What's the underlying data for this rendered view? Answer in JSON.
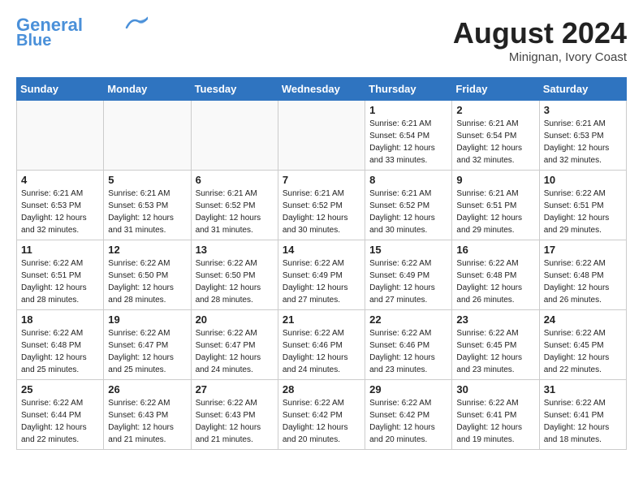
{
  "header": {
    "logo_line1": "General",
    "logo_line2": "Blue",
    "month_year": "August 2024",
    "location": "Minignan, Ivory Coast"
  },
  "weekdays": [
    "Sunday",
    "Monday",
    "Tuesday",
    "Wednesday",
    "Thursday",
    "Friday",
    "Saturday"
  ],
  "weeks": [
    [
      {
        "day": "",
        "info": ""
      },
      {
        "day": "",
        "info": ""
      },
      {
        "day": "",
        "info": ""
      },
      {
        "day": "",
        "info": ""
      },
      {
        "day": "1",
        "info": "Sunrise: 6:21 AM\nSunset: 6:54 PM\nDaylight: 12 hours\nand 33 minutes."
      },
      {
        "day": "2",
        "info": "Sunrise: 6:21 AM\nSunset: 6:54 PM\nDaylight: 12 hours\nand 32 minutes."
      },
      {
        "day": "3",
        "info": "Sunrise: 6:21 AM\nSunset: 6:53 PM\nDaylight: 12 hours\nand 32 minutes."
      }
    ],
    [
      {
        "day": "4",
        "info": "Sunrise: 6:21 AM\nSunset: 6:53 PM\nDaylight: 12 hours\nand 32 minutes."
      },
      {
        "day": "5",
        "info": "Sunrise: 6:21 AM\nSunset: 6:53 PM\nDaylight: 12 hours\nand 31 minutes."
      },
      {
        "day": "6",
        "info": "Sunrise: 6:21 AM\nSunset: 6:52 PM\nDaylight: 12 hours\nand 31 minutes."
      },
      {
        "day": "7",
        "info": "Sunrise: 6:21 AM\nSunset: 6:52 PM\nDaylight: 12 hours\nand 30 minutes."
      },
      {
        "day": "8",
        "info": "Sunrise: 6:21 AM\nSunset: 6:52 PM\nDaylight: 12 hours\nand 30 minutes."
      },
      {
        "day": "9",
        "info": "Sunrise: 6:21 AM\nSunset: 6:51 PM\nDaylight: 12 hours\nand 29 minutes."
      },
      {
        "day": "10",
        "info": "Sunrise: 6:22 AM\nSunset: 6:51 PM\nDaylight: 12 hours\nand 29 minutes."
      }
    ],
    [
      {
        "day": "11",
        "info": "Sunrise: 6:22 AM\nSunset: 6:51 PM\nDaylight: 12 hours\nand 28 minutes."
      },
      {
        "day": "12",
        "info": "Sunrise: 6:22 AM\nSunset: 6:50 PM\nDaylight: 12 hours\nand 28 minutes."
      },
      {
        "day": "13",
        "info": "Sunrise: 6:22 AM\nSunset: 6:50 PM\nDaylight: 12 hours\nand 28 minutes."
      },
      {
        "day": "14",
        "info": "Sunrise: 6:22 AM\nSunset: 6:49 PM\nDaylight: 12 hours\nand 27 minutes."
      },
      {
        "day": "15",
        "info": "Sunrise: 6:22 AM\nSunset: 6:49 PM\nDaylight: 12 hours\nand 27 minutes."
      },
      {
        "day": "16",
        "info": "Sunrise: 6:22 AM\nSunset: 6:48 PM\nDaylight: 12 hours\nand 26 minutes."
      },
      {
        "day": "17",
        "info": "Sunrise: 6:22 AM\nSunset: 6:48 PM\nDaylight: 12 hours\nand 26 minutes."
      }
    ],
    [
      {
        "day": "18",
        "info": "Sunrise: 6:22 AM\nSunset: 6:48 PM\nDaylight: 12 hours\nand 25 minutes."
      },
      {
        "day": "19",
        "info": "Sunrise: 6:22 AM\nSunset: 6:47 PM\nDaylight: 12 hours\nand 25 minutes."
      },
      {
        "day": "20",
        "info": "Sunrise: 6:22 AM\nSunset: 6:47 PM\nDaylight: 12 hours\nand 24 minutes."
      },
      {
        "day": "21",
        "info": "Sunrise: 6:22 AM\nSunset: 6:46 PM\nDaylight: 12 hours\nand 24 minutes."
      },
      {
        "day": "22",
        "info": "Sunrise: 6:22 AM\nSunset: 6:46 PM\nDaylight: 12 hours\nand 23 minutes."
      },
      {
        "day": "23",
        "info": "Sunrise: 6:22 AM\nSunset: 6:45 PM\nDaylight: 12 hours\nand 23 minutes."
      },
      {
        "day": "24",
        "info": "Sunrise: 6:22 AM\nSunset: 6:45 PM\nDaylight: 12 hours\nand 22 minutes."
      }
    ],
    [
      {
        "day": "25",
        "info": "Sunrise: 6:22 AM\nSunset: 6:44 PM\nDaylight: 12 hours\nand 22 minutes."
      },
      {
        "day": "26",
        "info": "Sunrise: 6:22 AM\nSunset: 6:43 PM\nDaylight: 12 hours\nand 21 minutes."
      },
      {
        "day": "27",
        "info": "Sunrise: 6:22 AM\nSunset: 6:43 PM\nDaylight: 12 hours\nand 21 minutes."
      },
      {
        "day": "28",
        "info": "Sunrise: 6:22 AM\nSunset: 6:42 PM\nDaylight: 12 hours\nand 20 minutes."
      },
      {
        "day": "29",
        "info": "Sunrise: 6:22 AM\nSunset: 6:42 PM\nDaylight: 12 hours\nand 20 minutes."
      },
      {
        "day": "30",
        "info": "Sunrise: 6:22 AM\nSunset: 6:41 PM\nDaylight: 12 hours\nand 19 minutes."
      },
      {
        "day": "31",
        "info": "Sunrise: 6:22 AM\nSunset: 6:41 PM\nDaylight: 12 hours\nand 18 minutes."
      }
    ]
  ]
}
